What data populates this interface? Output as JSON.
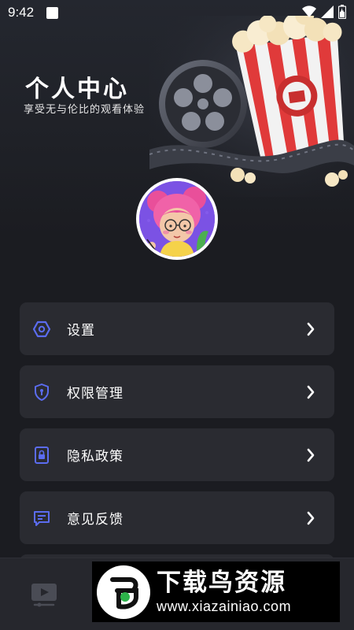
{
  "status_bar": {
    "time": "9:42"
  },
  "header": {
    "title": "个人中心",
    "subtitle": "享受无与伦比的观看体验"
  },
  "menu": {
    "items": [
      {
        "label": "设置",
        "icon": "settings-hexagon-icon"
      },
      {
        "label": "权限管理",
        "icon": "shield-icon"
      },
      {
        "label": "隐私政策",
        "icon": "document-lock-icon"
      },
      {
        "label": "意见反馈",
        "icon": "chat-bubble-icon"
      }
    ]
  },
  "tabbar": {
    "icons": [
      "video-play-icon"
    ]
  },
  "watermark": {
    "title": "下载鸟资源",
    "url": "www.xiazainiao.com"
  },
  "colors": {
    "background": "#1b1c21",
    "card": "#2a2b31",
    "icon_accent": "#5b6cf0",
    "text": "#ffffff"
  }
}
